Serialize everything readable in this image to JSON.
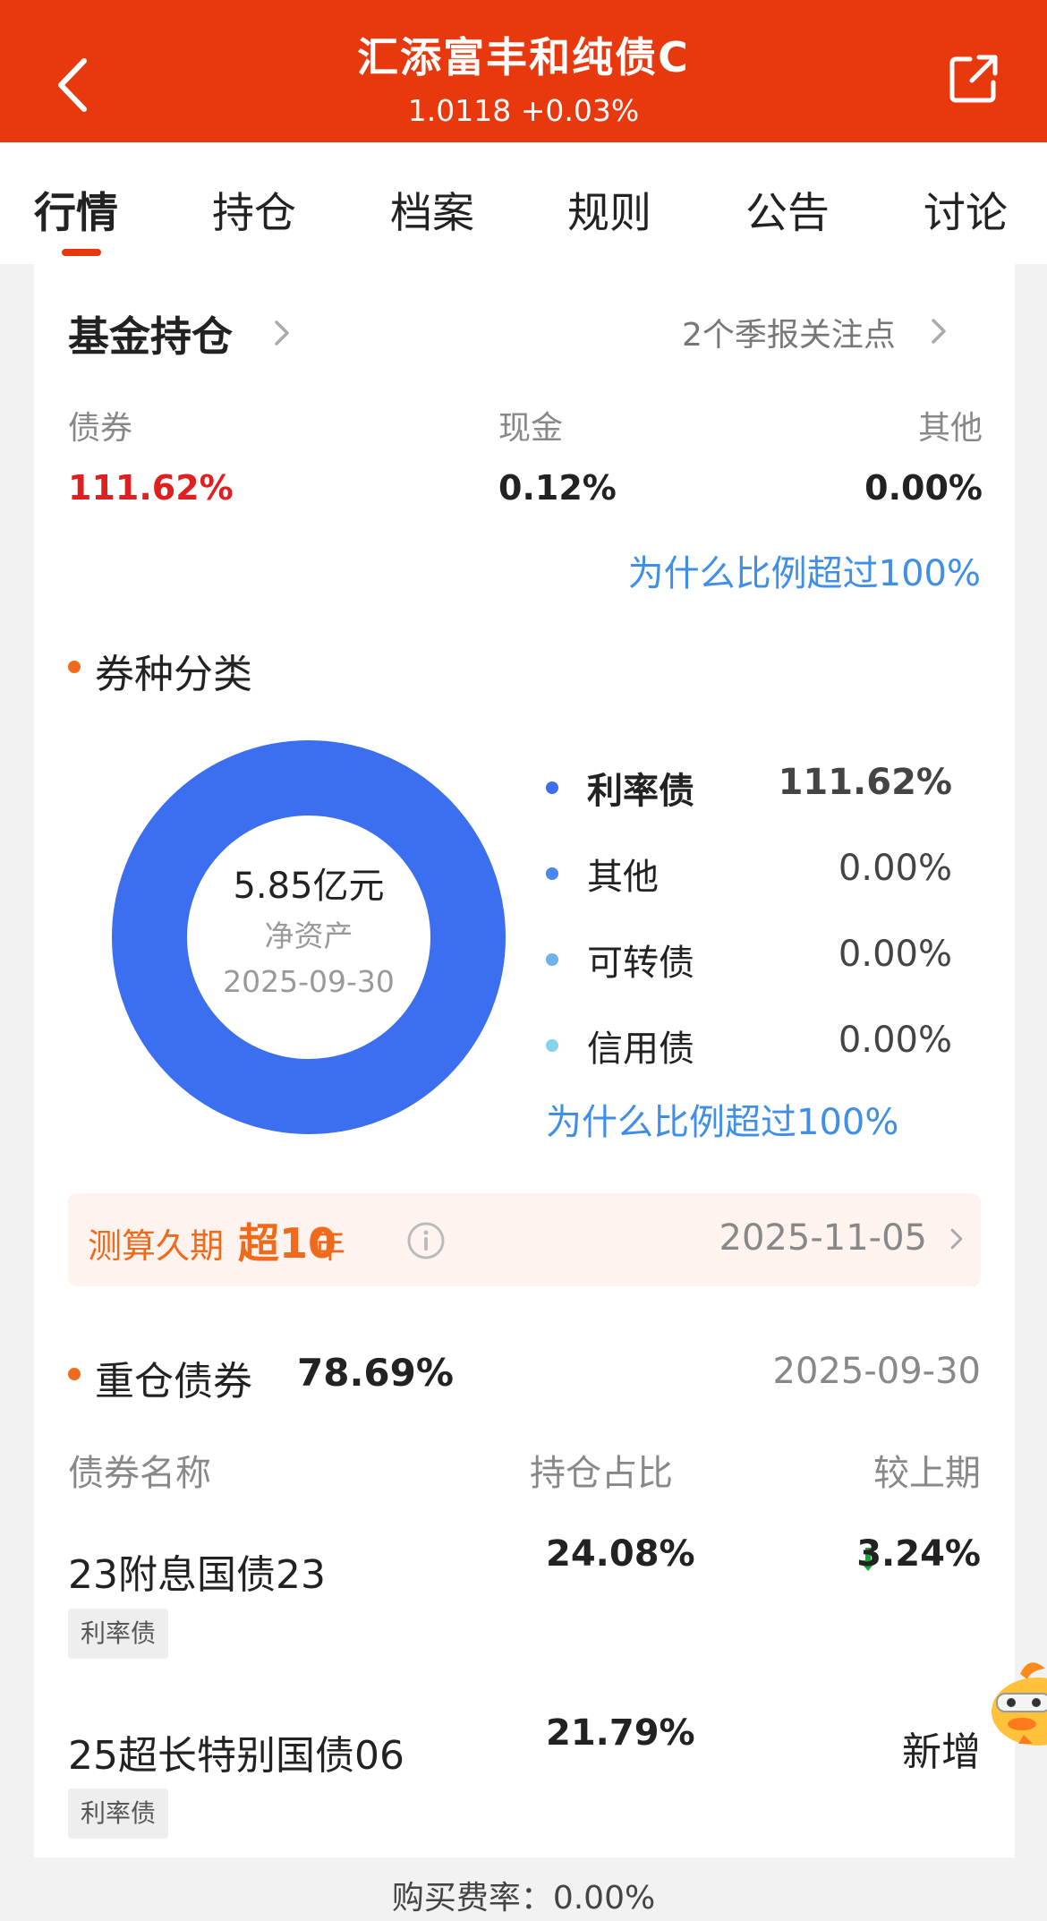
{
  "header": {
    "title": "汇添富丰和纯债C",
    "subtitle": "1.0118 +0.03%"
  },
  "tabs": [
    "行情",
    "持仓",
    "档案",
    "规则",
    "公告",
    "讨论"
  ],
  "holdings": {
    "title": "基金持仓",
    "quarter_link": "2个季报关注点",
    "assets": [
      {
        "label": "债券",
        "value": "111.62%",
        "color": "#e02020"
      },
      {
        "label": "现金",
        "value": "0.12%",
        "color": "#222222"
      },
      {
        "label": "其他",
        "value": "0.00%",
        "color": "#222222"
      }
    ],
    "why_link": "为什么比例超过100%"
  },
  "classification": {
    "title": "券种分类",
    "center_value": "5.85亿元",
    "center_label": "净资产",
    "center_date": "2025-09-30",
    "legend": [
      {
        "name": "利率债",
        "value": "111.62%",
        "color": "#3c6ef0",
        "bold": true
      },
      {
        "name": "其他",
        "value": "0.00%",
        "color": "#4a86f0",
        "bold": false
      },
      {
        "name": "可转债",
        "value": "0.00%",
        "color": "#6fb0ee",
        "bold": false
      },
      {
        "name": "信用债",
        "value": "0.00%",
        "color": "#86d0f0",
        "bold": false
      }
    ],
    "why_link": "为什么比例超过100%"
  },
  "duration": {
    "part_a": "测算久期",
    "part_b": "超10",
    "part_c": "年",
    "date": "2025-11-05"
  },
  "heavy": {
    "title": "重仓债券",
    "total": "78.69%",
    "date": "2025-09-30",
    "col_name": "债券名称",
    "col_pct": "持仓占比",
    "col_change": "较上期",
    "rows": [
      {
        "name": "23附息国债23",
        "tag": "利率债",
        "pct": "24.08%",
        "change": "3.24%",
        "direction": "down"
      },
      {
        "name": "25超长特别国债06",
        "tag": "利率债",
        "pct": "21.79%",
        "change": "新增",
        "direction": "new"
      }
    ]
  },
  "footer": {
    "text": "购买费率：0.00%"
  },
  "chart_data": {
    "type": "pie",
    "categories": [
      "利率债",
      "其他",
      "可转债",
      "信用债"
    ],
    "values": [
      111.62,
      0.0,
      0.0,
      0.0
    ],
    "colors": [
      "#3c6ef0",
      "#4a86f0",
      "#6fb0ee",
      "#86d0f0"
    ],
    "title": "",
    "xlabel": "",
    "ylabel": "",
    "donut": true,
    "legend": "right"
  }
}
